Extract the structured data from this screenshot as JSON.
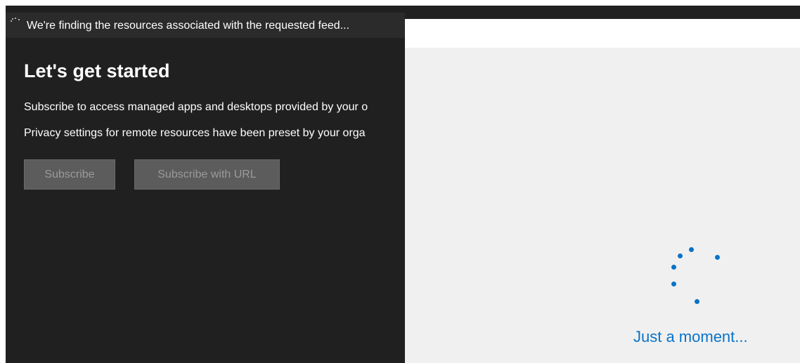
{
  "status": {
    "message": "We're finding the resources associated with the requested feed...",
    "icon": "loading-spinner-icon"
  },
  "main": {
    "title": "Let's get started",
    "description_1": "Subscribe to access managed apps and desktops provided by your o",
    "description_2": "Privacy settings for remote resources have been preset by your orga",
    "subscribe_label": "Subscribe",
    "subscribe_url_label": "Subscribe with URL"
  },
  "overlay": {
    "loading_text": "Just a moment...",
    "icon": "loading-spinner-icon"
  },
  "colors": {
    "background": "#202020",
    "accent": "#0a73c8",
    "overlay_background": "#f0f0f0",
    "button_disabled": "#5c5c5c"
  }
}
